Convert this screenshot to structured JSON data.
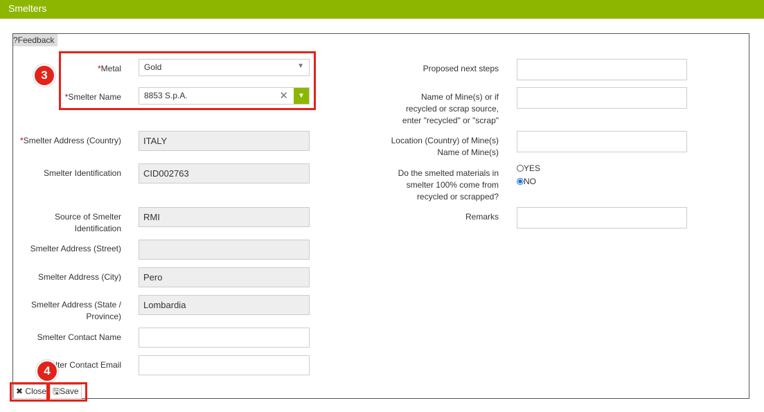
{
  "header": {
    "title": "Smelters"
  },
  "feedback_label": "?Feedback",
  "left": {
    "metal": {
      "label": "Metal",
      "value": "Gold"
    },
    "smelter_name": {
      "label": "Smelter Name",
      "value": "8853 S.p.A."
    },
    "country": {
      "label": "Smelter Address (Country)",
      "value": "ITALY"
    },
    "identification": {
      "label": "Smelter Identification",
      "value": "CID002763"
    },
    "source_id": {
      "label1": "Source of Smelter",
      "label2": "Identification",
      "value": "RMI"
    },
    "street": {
      "label": "Smelter Address (Street)",
      "value": ""
    },
    "city": {
      "label": "Smelter Address (City)",
      "value": "Pero"
    },
    "state": {
      "label1": "Smelter Address (State /",
      "label2": "Province)",
      "value": "Lombardia"
    },
    "contact_name": {
      "label": "Smelter Contact Name",
      "value": ""
    },
    "contact_email": {
      "label": "lter Contact Email",
      "value": ""
    }
  },
  "right": {
    "next_steps": {
      "label": "Proposed next steps",
      "value": ""
    },
    "mine_name": {
      "label1": "Name of Mine(s) or if",
      "label2": "recycled or scrap source,",
      "label3": "enter \"recycled\" or \"scrap\"",
      "value": ""
    },
    "mine_location": {
      "label1": "Location (Country) of Mine(s)",
      "label2": "Name of Mine(s)",
      "value": ""
    },
    "recycled": {
      "label1": "Do the smelted materials in",
      "label2": "smelter 100% come from",
      "label3": "recycled or scrapped?",
      "yes": "YES",
      "no": "NO",
      "selected": "NO"
    },
    "remarks": {
      "label": "Remarks",
      "value": ""
    }
  },
  "required_mark": "*",
  "buttons": {
    "close": "Close",
    "save": "Save"
  },
  "annotations": {
    "step3": "3",
    "step4": "4"
  },
  "colors": {
    "accent": "#8db600",
    "highlight": "#e2231a"
  }
}
